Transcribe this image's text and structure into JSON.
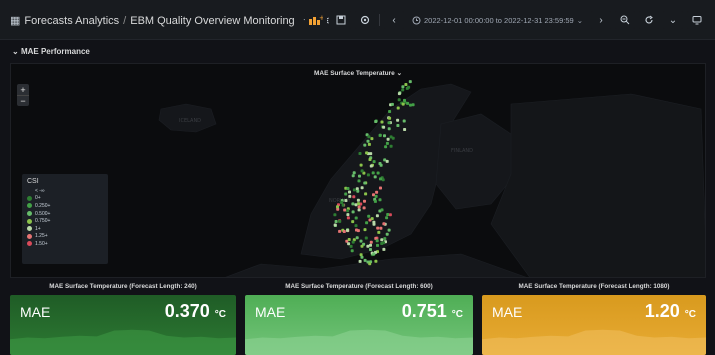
{
  "header": {
    "breadcrumb": [
      "Forecasts Analytics",
      "EBM Quality Overview Monitoring"
    ],
    "separator": "/",
    "time_range": "2022-12-01 00:00:00 to 2022-12-31 23:59:59",
    "accent_color": "#f2a134"
  },
  "row": {
    "title": "MAE Performance",
    "collapse_glyph": "⌄"
  },
  "map_panel": {
    "title": "MAE Surface Temperature",
    "zoom_in": "+",
    "zoom_out": "−",
    "country_labels": [
      "ICELAND",
      "FINLAND",
      "NORWAY"
    ],
    "legend": {
      "title": "CSI",
      "items": [
        {
          "label": "< -∞",
          "color": ""
        },
        {
          "label": "0+",
          "color": "#2e7d32"
        },
        {
          "label": "0.250+",
          "color": "#43a047"
        },
        {
          "label": "0.500+",
          "color": "#66bb6a"
        },
        {
          "label": "0.750+",
          "color": "#8bc34a"
        },
        {
          "label": "1+",
          "color": "#b9d9a8"
        },
        {
          "label": "1.25+",
          "color": "#e57373"
        },
        {
          "label": "1.50+",
          "color": "#d94a5a"
        }
      ]
    }
  },
  "stats": [
    {
      "title": "MAE Surface Temperature (Forecast Length: 240)",
      "label": "MAE",
      "value": "0.370",
      "unit": "°C",
      "color_top": "#1f5c26",
      "color_bottom": "#2d7a33",
      "spark": "#3e9a45",
      "level": 0.37
    },
    {
      "title": "MAE Surface Temperature (Forecast Length: 600)",
      "label": "MAE",
      "value": "0.751",
      "unit": "°C",
      "color_top": "#4fae55",
      "color_bottom": "#73c47a",
      "spark": "#8fd496",
      "level": 0.751
    },
    {
      "title": "MAE Surface Temperature (Forecast Length: 1080)",
      "label": "MAE",
      "value": "1.20",
      "unit": "°C",
      "color_top": "#d89a1e",
      "color_bottom": "#e8ab34",
      "spark": "#f0c060",
      "level": 1.2
    }
  ]
}
